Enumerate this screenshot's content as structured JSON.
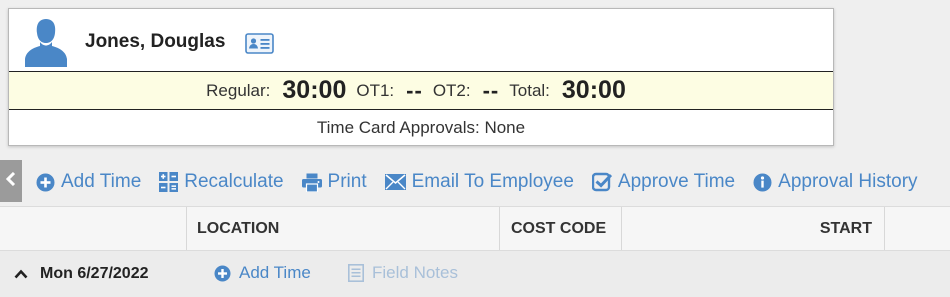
{
  "employee": {
    "name": "Jones, Douglas",
    "totals": {
      "regular_label": "Regular:",
      "regular_value": "30:00",
      "ot1_label": "OT1:",
      "ot1_value": "--",
      "ot2_label": "OT2:",
      "ot2_value": "--",
      "total_label": "Total:",
      "total_value": "30:00"
    },
    "approvals_text": "Time Card Approvals: None"
  },
  "toolbar": {
    "items": [
      {
        "label": "Add Time",
        "icon": "plus-circle-icon"
      },
      {
        "label": "Recalculate",
        "icon": "calculator-icon"
      },
      {
        "label": "Print",
        "icon": "printer-icon"
      },
      {
        "label": "Email To Employee",
        "icon": "envelope-icon"
      },
      {
        "label": "Approve Time",
        "icon": "check-square-icon"
      },
      {
        "label": "Approval History",
        "icon": "info-circle-icon"
      }
    ]
  },
  "table": {
    "columns": [
      "LOCATION",
      "COST CODE",
      "START"
    ]
  },
  "day": {
    "label": "Mon 6/27/2022",
    "add_time_label": "Add Time",
    "field_notes_label": "Field Notes"
  },
  "colors": {
    "accent": "#4a87c7",
    "accent_disabled": "#a9c0d9",
    "totals_bg": "#fdfde3",
    "avatar": "#4a87c7"
  }
}
